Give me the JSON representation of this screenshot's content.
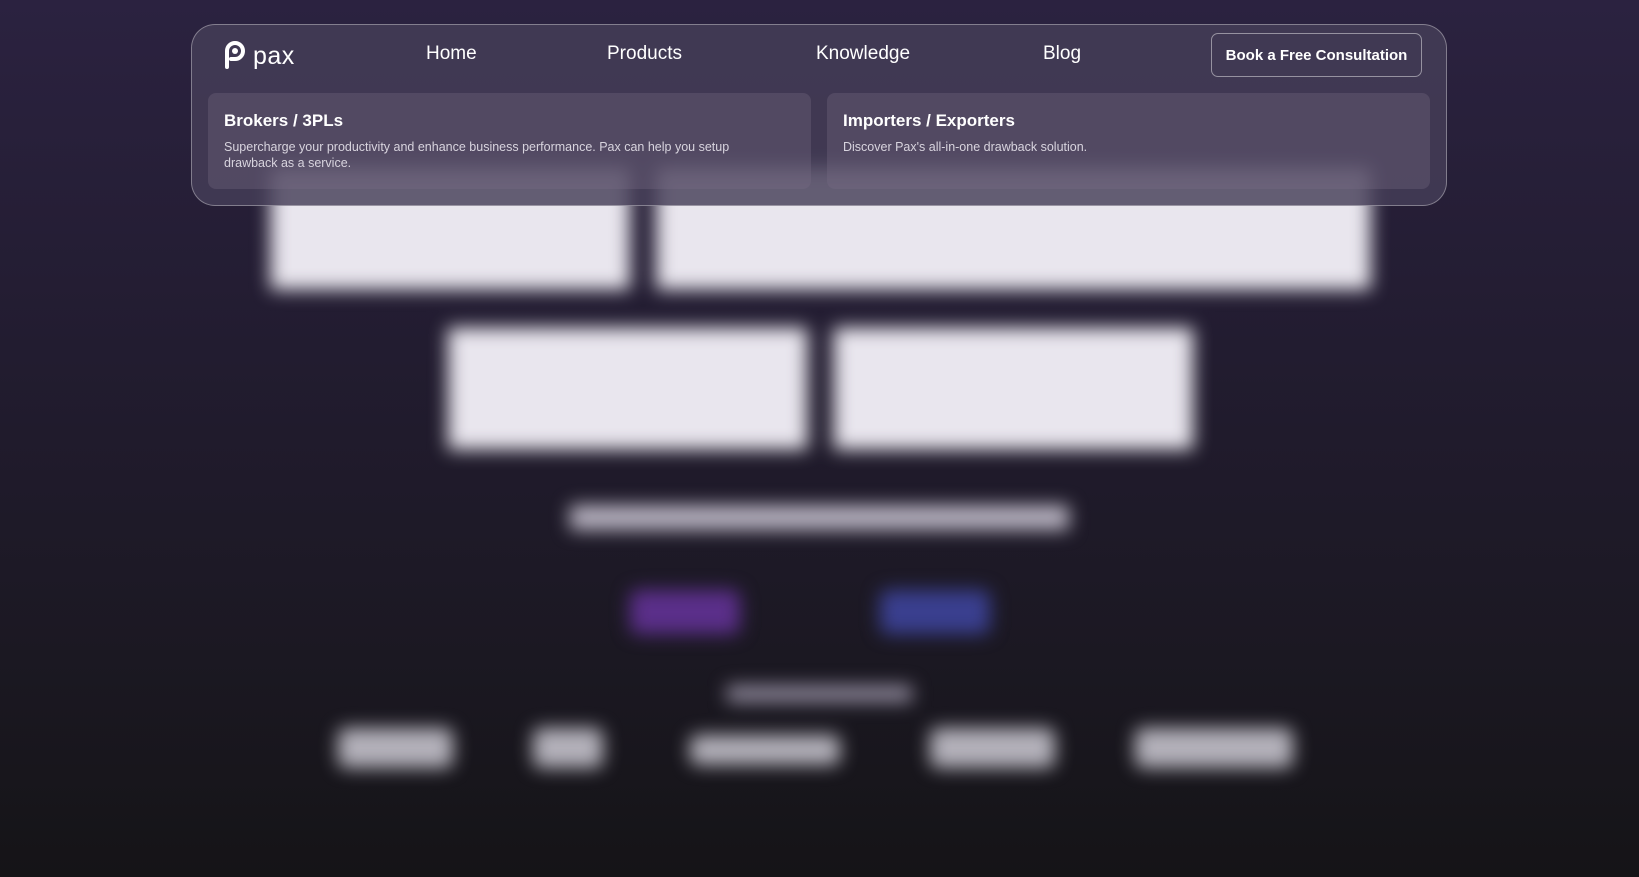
{
  "brand": {
    "name": "pax",
    "icon": "pax-logo-icon"
  },
  "nav": {
    "links": [
      "Home",
      "Products",
      "Knowledge",
      "Blog"
    ],
    "cta_label": "Book a Free Consultation"
  },
  "products_menu": {
    "items": [
      {
        "title": "Brokers / 3PLs",
        "description": "Supercharge your productivity and enhance business performance. Pax can help you setup drawback as a service."
      },
      {
        "title": "Importers / Exporters",
        "description": "Discover Pax's all-in-one drawback solution."
      }
    ]
  },
  "colors": {
    "background_top": "#2b2240",
    "background_bottom": "#151417",
    "panel": "#463e58"
  }
}
